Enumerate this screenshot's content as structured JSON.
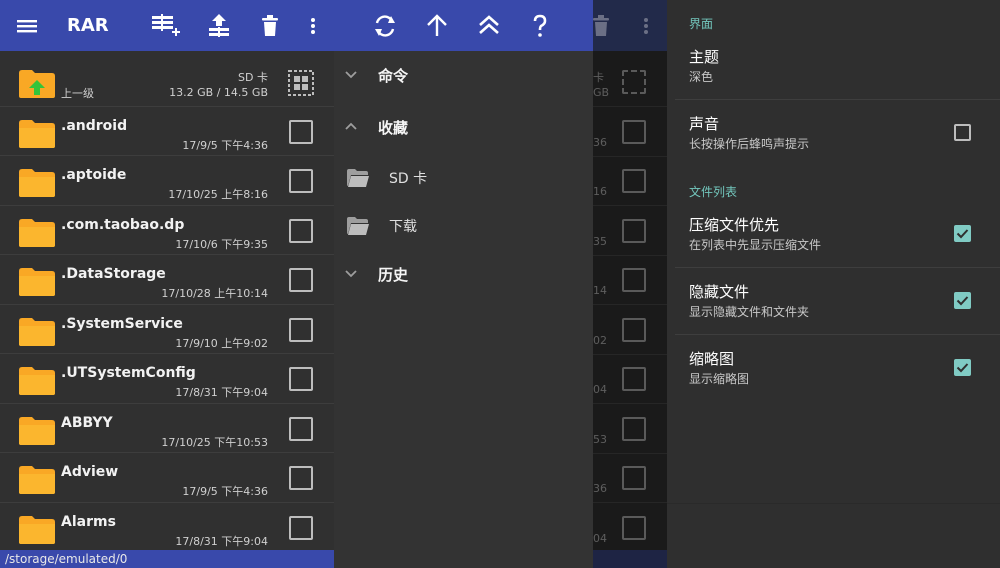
{
  "app": {
    "title": "RAR",
    "toolbar_color": "#3949ab",
    "folder_color": "#f9a825",
    "accent_color": "#80cbc4"
  },
  "toolbar_left": {
    "icons": [
      "menu-icon",
      "add-to-archive-icon",
      "extract-icon",
      "delete-icon",
      "more-vert-icon"
    ]
  },
  "toolbar_drawer": {
    "icons": [
      "refresh-icon",
      "arrow-up-icon",
      "double-chevron-up-icon",
      "help-icon"
    ]
  },
  "file_list": {
    "parent": {
      "label": "上一级",
      "storage": "SD 卡",
      "size": "13.2 GB / 14.5 GB"
    },
    "items": [
      {
        "name": ".android",
        "date": "17/9/5 下午4:36"
      },
      {
        "name": ".aptoide",
        "date": "17/10/25 上午8:16"
      },
      {
        "name": ".com.taobao.dp",
        "date": "17/10/6 下午9:35"
      },
      {
        "name": ".DataStorage",
        "date": "17/10/28 上午10:14"
      },
      {
        "name": ".SystemService",
        "date": "17/9/10 上午9:02"
      },
      {
        "name": ".UTSystemConfig",
        "date": "17/8/31 下午9:04"
      },
      {
        "name": "ABBYY",
        "date": "17/10/25 下午10:53"
      },
      {
        "name": "Adview",
        "date": "17/9/5 下午4:36"
      },
      {
        "name": "Alarms",
        "date": "17/8/31 下午9:04"
      }
    ],
    "path": "/storage/emulated/0"
  },
  "drawer": {
    "commands_label": "命令",
    "favorites_label": "收藏",
    "favorites": [
      "SD 卡",
      "下载"
    ],
    "history_label": "历史"
  },
  "dimmed_fragments": [
    "卡",
    "GB",
    "36",
    "16",
    "35",
    "14",
    "02",
    "04",
    "53",
    "36",
    "04"
  ],
  "settings": {
    "section_interface": "界面",
    "theme_title": "主题",
    "theme_value": "深色",
    "sound_title": "声音",
    "sound_desc": "长按操作后蜂鸣声提示",
    "sound_checked": false,
    "section_file_list": "文件列表",
    "archives_first_title": "压缩文件优先",
    "archives_first_desc": "在列表中先显示压缩文件",
    "archives_first_checked": true,
    "hidden_files_title": "隐藏文件",
    "hidden_files_desc": "显示隐藏文件和文件夹",
    "hidden_files_checked": true,
    "thumbnails_title": "缩略图",
    "thumbnails_desc": "显示缩略图",
    "thumbnails_checked": true
  }
}
